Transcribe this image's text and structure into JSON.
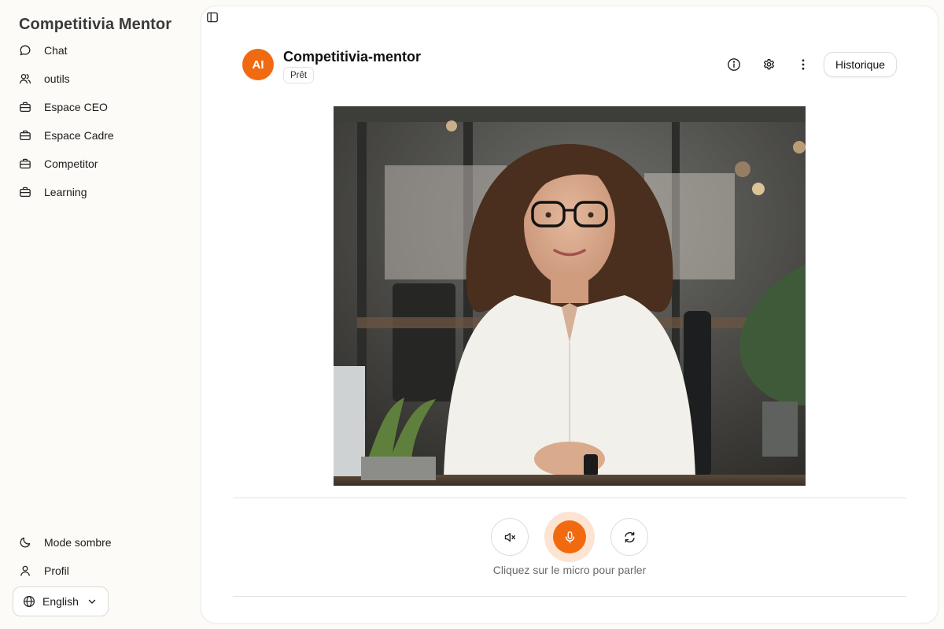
{
  "app": {
    "title": "Competitivia Mentor"
  },
  "sidebar": {
    "items": [
      {
        "label": "Chat",
        "icon": "chat-bubble-icon"
      },
      {
        "label": "outils",
        "icon": "users-icon"
      },
      {
        "label": "Espace CEO",
        "icon": "briefcase-icon"
      },
      {
        "label": "Espace Cadre",
        "icon": "briefcase-icon"
      },
      {
        "label": "Competitor",
        "icon": "briefcase-icon"
      },
      {
        "label": "Learning",
        "icon": "briefcase-icon"
      }
    ],
    "bottom_items": [
      {
        "label": "Mode sombre",
        "icon": "moon-icon"
      },
      {
        "label": "Profil",
        "icon": "user-icon"
      }
    ],
    "language": {
      "label": "English"
    }
  },
  "header": {
    "avatar_text": "AI",
    "agent_name": "Competitivia-mentor",
    "status": "Prêt",
    "history_button": "Historique"
  },
  "controls": {
    "hint": "Cliquez sur le micro pour parler"
  },
  "colors": {
    "accent": "#f26a0f",
    "background": "#fcfbf7",
    "panel": "#ffffff"
  }
}
